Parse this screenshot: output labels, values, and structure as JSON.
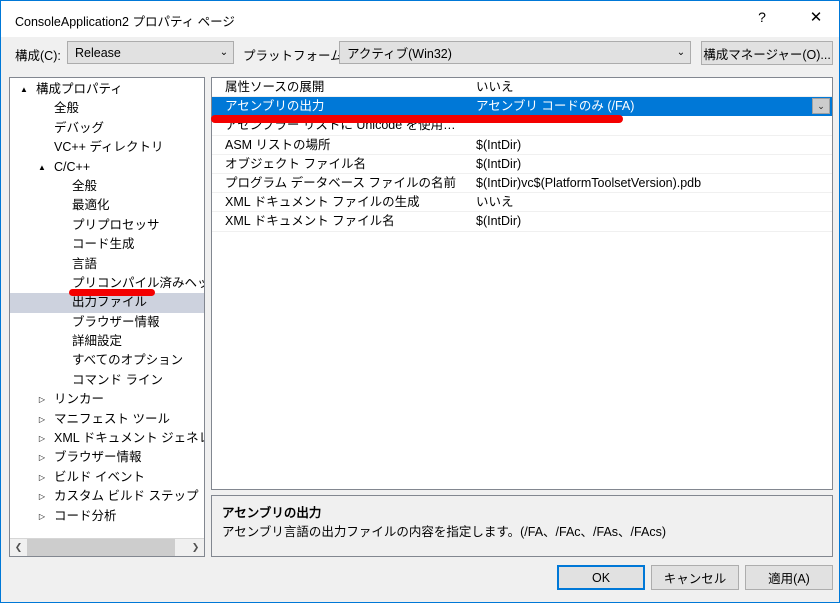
{
  "window": {
    "title": "ConsoleApplication2 プロパティ ページ",
    "help_label": "?",
    "close_label": "✕",
    "accent_color": "#0078d7",
    "selection_color": "#0078d7",
    "annotation_color": "#f40000"
  },
  "configbar": {
    "configuration_label": "構成(C):",
    "configuration_value": "Release",
    "platform_label": "プラットフォーム(P):",
    "platform_value": "アクティブ(Win32)",
    "config_manager_label": "構成マネージャー(O)...",
    "dropdown_arrow": "⌄"
  },
  "tree": {
    "items": [
      {
        "label": "構成プロパティ",
        "indent": 0,
        "arrow": "▲",
        "expanded": true,
        "selected": false
      },
      {
        "label": "全般",
        "indent": 1,
        "arrow": "",
        "expanded": false,
        "selected": false
      },
      {
        "label": "デバッグ",
        "indent": 1,
        "arrow": "",
        "expanded": false,
        "selected": false
      },
      {
        "label": "VC++ ディレクトリ",
        "indent": 1,
        "arrow": "",
        "expanded": false,
        "selected": false
      },
      {
        "label": "C/C++",
        "indent": 1,
        "arrow": "▲",
        "expanded": true,
        "selected": false
      },
      {
        "label": "全般",
        "indent": 2,
        "arrow": "",
        "expanded": false,
        "selected": false
      },
      {
        "label": "最適化",
        "indent": 2,
        "arrow": "",
        "expanded": false,
        "selected": false
      },
      {
        "label": "プリプロセッサ",
        "indent": 2,
        "arrow": "",
        "expanded": false,
        "selected": false
      },
      {
        "label": "コード生成",
        "indent": 2,
        "arrow": "",
        "expanded": false,
        "selected": false
      },
      {
        "label": "言語",
        "indent": 2,
        "arrow": "",
        "expanded": false,
        "selected": false
      },
      {
        "label": "プリコンパイル済みヘッダー",
        "indent": 2,
        "arrow": "",
        "expanded": false,
        "selected": false
      },
      {
        "label": "出力ファイル",
        "indent": 2,
        "arrow": "",
        "expanded": false,
        "selected": true
      },
      {
        "label": "ブラウザー情報",
        "indent": 2,
        "arrow": "",
        "expanded": false,
        "selected": false
      },
      {
        "label": "詳細設定",
        "indent": 2,
        "arrow": "",
        "expanded": false,
        "selected": false
      },
      {
        "label": "すべてのオプション",
        "indent": 2,
        "arrow": "",
        "expanded": false,
        "selected": false
      },
      {
        "label": "コマンド ライン",
        "indent": 2,
        "arrow": "",
        "expanded": false,
        "selected": false
      },
      {
        "label": "リンカー",
        "indent": 1,
        "arrow": "▷",
        "expanded": false,
        "selected": false
      },
      {
        "label": "マニフェスト ツール",
        "indent": 1,
        "arrow": "▷",
        "expanded": false,
        "selected": false
      },
      {
        "label": "XML ドキュメント ジェネレーター",
        "indent": 1,
        "arrow": "▷",
        "expanded": false,
        "selected": false
      },
      {
        "label": "ブラウザー情報",
        "indent": 1,
        "arrow": "▷",
        "expanded": false,
        "selected": false
      },
      {
        "label": "ビルド イベント",
        "indent": 1,
        "arrow": "▷",
        "expanded": false,
        "selected": false
      },
      {
        "label": "カスタム ビルド ステップ",
        "indent": 1,
        "arrow": "▷",
        "expanded": false,
        "selected": false
      },
      {
        "label": "コード分析",
        "indent": 1,
        "arrow": "▷",
        "expanded": false,
        "selected": false
      }
    ],
    "scrollbar": {
      "left_arrow": "❮",
      "right_arrow": "❯"
    }
  },
  "grid": {
    "rows": [
      {
        "name": "属性ソースの展開",
        "value": "いいえ",
        "selected": false,
        "has_dropdown": false
      },
      {
        "name": "アセンブリの出力",
        "value": "アセンブリ コードのみ (/FA)",
        "selected": true,
        "has_dropdown": true
      },
      {
        "name": "アセンブラー リストに Unicode を使用する",
        "value": "",
        "selected": false,
        "has_dropdown": false
      },
      {
        "name": "ASM リストの場所",
        "value": "$(IntDir)",
        "selected": false,
        "has_dropdown": false
      },
      {
        "name": "オブジェクト ファイル名",
        "value": "$(IntDir)",
        "selected": false,
        "has_dropdown": false
      },
      {
        "name": "プログラム データベース ファイルの名前",
        "value": "$(IntDir)vc$(PlatformToolsetVersion).pdb",
        "selected": false,
        "has_dropdown": false
      },
      {
        "name": "XML ドキュメント ファイルの生成",
        "value": "いいえ",
        "selected": false,
        "has_dropdown": false
      },
      {
        "name": "XML ドキュメント ファイル名",
        "value": "$(IntDir)",
        "selected": false,
        "has_dropdown": false
      }
    ],
    "dropdown_arrow": "⌄"
  },
  "description": {
    "title": "アセンブリの出力",
    "body": "アセンブリ言語の出力ファイルの内容を指定します。(/FA、/FAc、/FAs、/FAcs)"
  },
  "footer": {
    "ok_label": "OK",
    "cancel_label": "キャンセル",
    "apply_label": "適用(A)"
  }
}
